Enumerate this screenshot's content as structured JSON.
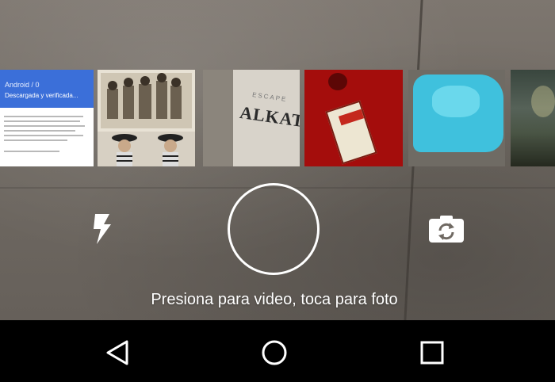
{
  "gallery": {
    "thumbnails": [
      {
        "name": "screenshot",
        "title": "Android / 0",
        "subtitle": "Descargada y verificada..."
      },
      {
        "name": "sepia-photo"
      },
      {
        "name": "alkatraz-card",
        "logo_text": "ALKATRAZ",
        "sub_text": "ESCAPE"
      },
      {
        "name": "red-gift-card"
      },
      {
        "name": "blue-bag"
      },
      {
        "name": "night-landscape"
      }
    ]
  },
  "controls": {
    "flash_icon": "flash-icon",
    "shutter": "shutter-button",
    "switch_camera_icon": "switch-camera-icon",
    "hint_text": "Presiona para video, toca para foto"
  },
  "navigation": {
    "back_icon": "back-icon",
    "home_icon": "home-icon",
    "recents_icon": "recents-icon"
  },
  "colors": {
    "nav_background": "#000000",
    "accent_blue": "#3b6fd9",
    "shutter_ring": "#ffffff"
  }
}
